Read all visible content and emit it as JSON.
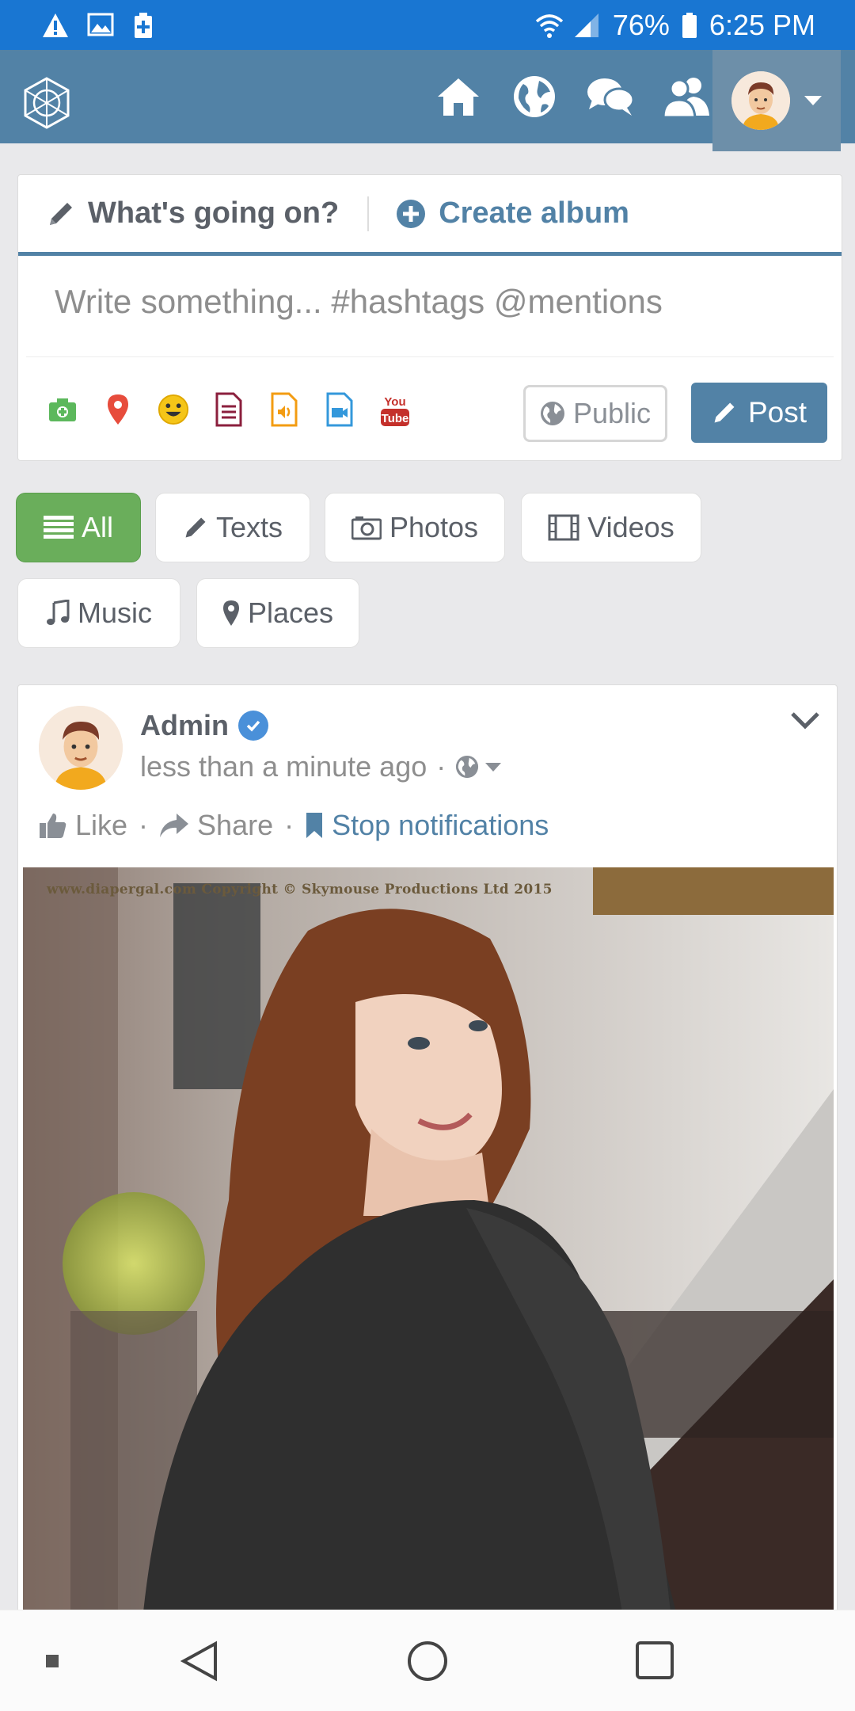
{
  "status_bar": {
    "battery": "76%",
    "time": "6:25 PM",
    "icons": [
      "alert-icon",
      "image-icon",
      "battery-saver-icon",
      "wifi-icon",
      "signal-icon",
      "battery-icon"
    ]
  },
  "app_bar": {
    "nav": [
      "home-icon",
      "globe-icon",
      "chat-icon",
      "users-icon"
    ],
    "accent": "#5282a6"
  },
  "composer": {
    "tab_status": "What's going on?",
    "tab_album": "Create album",
    "placeholder": "Write something... #hashtags @mentions",
    "tools": [
      "camera-icon",
      "location-icon",
      "smiley-icon",
      "document-icon",
      "audio-file-icon",
      "video-file-icon",
      "youtube-icon"
    ],
    "privacy": "Public",
    "post": "Post"
  },
  "filters": {
    "all": "All",
    "texts": "Texts",
    "photos": "Photos",
    "videos": "Videos",
    "music": "Music",
    "places": "Places"
  },
  "post": {
    "author": "Admin",
    "time": "less than a minute ago",
    "separator": "·",
    "like": "Like",
    "share": "Share",
    "stop": "Stop notifications",
    "watermark": "www.diapergal.com Copyright © Skymouse Productions Ltd 2015"
  }
}
